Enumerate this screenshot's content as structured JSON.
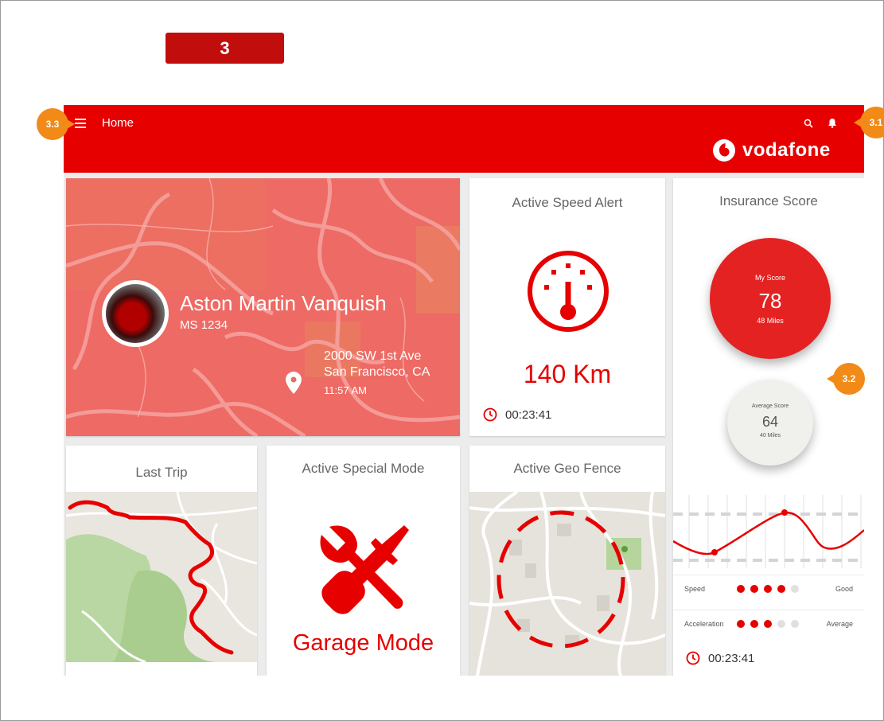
{
  "step": "3",
  "callouts": {
    "c31": "3.1",
    "c32": "3.2",
    "c33": "3.3"
  },
  "appbar": {
    "title": "Home",
    "menu_icon": "menu-icon",
    "search_icon": "search-icon",
    "bell_icon": "bell-icon",
    "brand": "vodafone",
    "color": "#e60000"
  },
  "vehicle": {
    "name": "Aston Martin Vanquish",
    "plate": "MS 1234",
    "address_line1": "2000 SW 1st Ave",
    "address_line2": "San Francisco, CA",
    "time": "11:57 AM"
  },
  "speed_alert": {
    "title": "Active Speed Alert",
    "value": "140 Km",
    "timer": "00:23:41"
  },
  "insurance": {
    "title": "Insurance Score",
    "my_score_label": "My Score",
    "my_score": "78",
    "my_miles": "48 Miles",
    "avg_score_label": "Average Score",
    "avg_score": "64",
    "avg_miles": "40 Miles",
    "metrics": [
      {
        "label": "Speed",
        "level": 4,
        "max": 5,
        "rating": "Good"
      },
      {
        "label": "Acceleration",
        "level": 3,
        "max": 5,
        "rating": "Average"
      }
    ],
    "timer": "00:23:41"
  },
  "last_trip": {
    "title": "Last Trip"
  },
  "special_mode": {
    "title": "Active Special Mode",
    "mode": "Garage Mode",
    "icon": "tools-icon"
  },
  "geo_fence": {
    "title": "Active Geo Fence"
  },
  "accent_color": "#e60000",
  "callout_color": "#f18a16"
}
